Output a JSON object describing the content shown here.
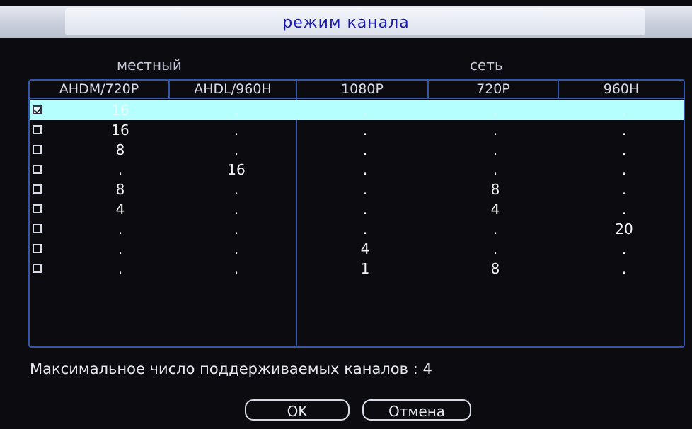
{
  "title": "режим канала",
  "groups": {
    "local": "местный",
    "network": "сеть"
  },
  "columns": [
    "AHDM/720P",
    "AHDL/960H",
    "1080P",
    "720P",
    "960H"
  ],
  "rows": [
    {
      "checked": true,
      "cells": [
        "16",
        ".",
        ".",
        ".",
        "."
      ]
    },
    {
      "checked": false,
      "cells": [
        "16",
        ".",
        ".",
        ".",
        "."
      ]
    },
    {
      "checked": false,
      "cells": [
        "8",
        ".",
        ".",
        ".",
        "."
      ]
    },
    {
      "checked": false,
      "cells": [
        ".",
        "16",
        ".",
        ".",
        "."
      ]
    },
    {
      "checked": false,
      "cells": [
        "8",
        ".",
        ".",
        "8",
        "."
      ]
    },
    {
      "checked": false,
      "cells": [
        "4",
        ".",
        ".",
        "4",
        "."
      ]
    },
    {
      "checked": false,
      "cells": [
        ".",
        ".",
        ".",
        ".",
        "20"
      ]
    },
    {
      "checked": false,
      "cells": [
        ".",
        ".",
        "4",
        ".",
        "."
      ]
    },
    {
      "checked": false,
      "cells": [
        ".",
        ".",
        "1",
        "8",
        "."
      ]
    }
  ],
  "max_channels_text": "Максимальное число поддерживаемых каналов : 4",
  "buttons": {
    "ok": "OK",
    "cancel": "Отмена"
  },
  "colors": {
    "title": "#1b1bb0",
    "selected_row": "#b6ffff",
    "grid_line": "#3355aa"
  }
}
